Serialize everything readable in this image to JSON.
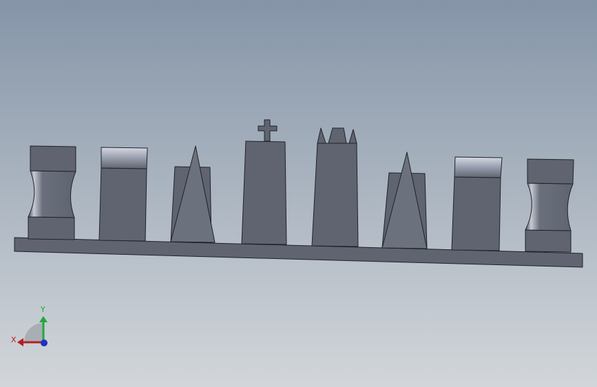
{
  "viewport": {
    "background_top": "#8595a8",
    "background_bottom": "#d2d6da"
  },
  "model": {
    "face_color": "#5f6470",
    "edge_color": "#1f2228",
    "pieces": [
      "rook",
      "pawn",
      "bishop",
      "king",
      "queen",
      "bishop",
      "pawn",
      "rook"
    ]
  },
  "triad": {
    "x_label": "X",
    "y_label": "Y",
    "x_color": "#b42020",
    "y_color": "#1fa83a",
    "z_color": "#2030c0"
  }
}
